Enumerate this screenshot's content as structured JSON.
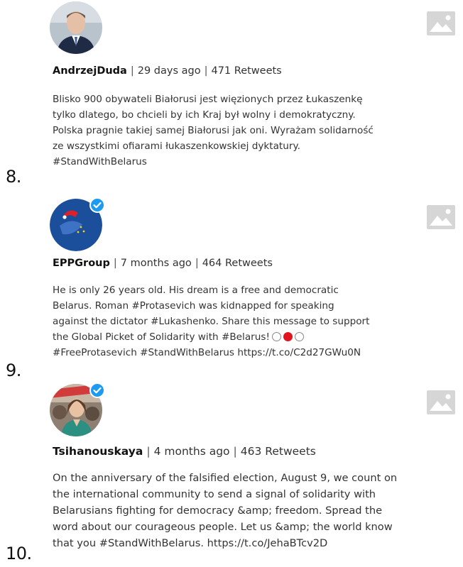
{
  "entries": [
    {
      "rank": "8.",
      "username": "AndrzejDuda",
      "time": "29 days ago",
      "retweets": "471 Retweets",
      "verified": false,
      "lines": [
        "Blisko 900 obywateli Białorusi jest więzionych przez Łukaszenkę",
        "tylko dlatego, bo chcieli by ich Kraj był wolny i demokratyczny.",
        "Polska pragnie takiej samej Białorusi jak oni. Wyrażam solidarność",
        "ze wszystkimi ofiarami łukaszenkowskiej dyktatury.",
        "#StandWithBelarus"
      ]
    },
    {
      "rank": "9.",
      "username": "EPPGroup",
      "time": "7 months ago",
      "retweets": "464 Retweets",
      "verified": true,
      "lines": [
        "He is only 26 years old. His dream is a free and democratic",
        "Belarus. Roman #Protasevich was kidnapped for speaking",
        "against the dictator #Lukashenko. Share this message to support",
        "the Global Picket of Solidarity with #Belarus!",
        "#FreeProtasevich #StandWithBelarus https://t.co/C2d27GWu0N"
      ]
    },
    {
      "rank": "10.",
      "username": "Tsihanouskaya",
      "time": "4 months ago",
      "retweets": "463 Retweets",
      "verified": true,
      "lines": [
        "On the anniversary of the falsified election, August 9, we count on",
        "the international community to send a signal of solidarity with",
        "Belarusians fighting for democracy &amp; freedom. Spread the",
        "word about our courageous people. Let us &amp; the world know",
        "that you #StandWithBelarus. https://t.co/JehaBTcv2D"
      ]
    }
  ],
  "icons": {
    "image_placeholder": "image-placeholder-icon",
    "verified": "verified-badge-icon",
    "flag_circles": [
      "white",
      "red",
      "white"
    ]
  },
  "colors": {
    "verified": "#1d9bf0",
    "placeholder": "#d6d6d6",
    "flag_red": "#e0151f"
  }
}
